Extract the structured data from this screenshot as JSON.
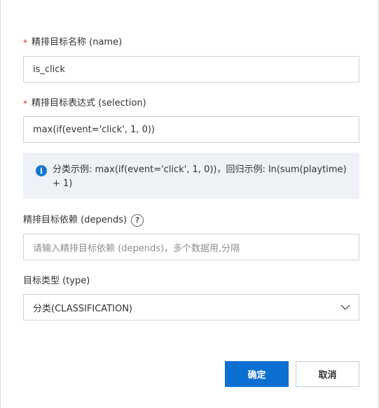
{
  "form": {
    "name_field": {
      "required_mark": "*",
      "label": "精排目标名称 (name)",
      "value": "is_click"
    },
    "selection_field": {
      "required_mark": "*",
      "label": "精排目标表达式 (selection)",
      "value": "max(if(event='click', 1, 0))"
    },
    "info": {
      "icon": "info-icon",
      "text": "分类示例: max(if(event='click', 1, 0))，回归示例: ln(sum(playtime) + 1)"
    },
    "depends_field": {
      "label": "精排目标依赖 (depends)",
      "help_icon": "?",
      "placeholder": "请输入精排目标依赖 (depends)，多个数据用,分隔"
    },
    "type_field": {
      "label": "目标类型 (type)",
      "selected": "分类(CLASSIFICATION)"
    }
  },
  "footer": {
    "confirm_label": "确定",
    "cancel_label": "取消"
  },
  "colors": {
    "primary": "#0b6fd1",
    "required": "#e0302b",
    "info_bg": "#eef1f5",
    "info_icon": "#1677ce"
  }
}
